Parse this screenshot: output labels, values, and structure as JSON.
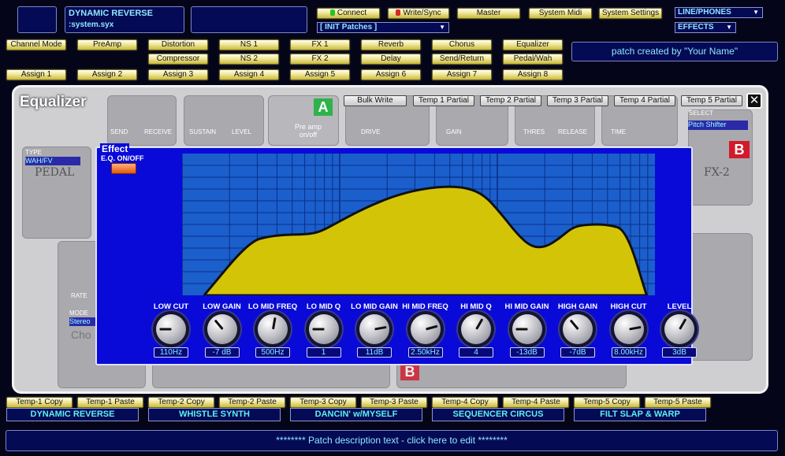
{
  "header": {
    "patch_name": "DYNAMIC REVERSE",
    "file_name": ":system.syx",
    "connect": "Connect",
    "write_sync": "Write/Sync",
    "master": "Master",
    "system_midi": "System Midi",
    "system_settings": "System Settings",
    "patch_select": "[ INIT Patches ]",
    "output_select": "LINE/PHONES",
    "mode_select": "EFFECTS",
    "connect_led": "#27c41f",
    "write_led": "#d9262b"
  },
  "effects_row1": [
    "Channel Mode",
    "PreAmp",
    "Distortion",
    "NS 1",
    "FX 1",
    "Reverb",
    "Chorus",
    "Equalizer"
  ],
  "effects_row2": [
    "Compressor",
    "NS 2",
    "FX 2",
    "Delay",
    "Send/Return",
    "Pedal/Wah"
  ],
  "patch_created": "patch created by \"Your Name\"",
  "assigns": [
    "Assign 1",
    "Assign 2",
    "Assign 3",
    "Assign 4",
    "Assign 5",
    "Assign 6",
    "Assign 7",
    "Assign 8"
  ],
  "panel": {
    "title": "Equalizer",
    "bulk_write": "Bulk Write",
    "temp_partials": [
      "Temp 1 Partial",
      "Temp 2 Partial",
      "Temp 3 Partial",
      "Temp 4 Partial",
      "Temp 5 Partial"
    ],
    "close": "✕",
    "bg": {
      "send": "SEND",
      "receive": "RECEIVE",
      "sustain": "SUSTAIN",
      "level": "LEVEL",
      "preamp_onoff": "Pre amp\non/off",
      "a_letter": "A",
      "b_letter": "B",
      "drive": "DRIVE",
      "gain": "GAIN",
      "thres": "THRES",
      "release": "RELEASE",
      "time": "TIME",
      "select": "SELECT",
      "fx_select": "Pitch Shifter",
      "type": "TYPE",
      "type_value": "WAH/FV",
      "pedal": "PEDAL",
      "fx2": "FX-2",
      "rate": "RATE",
      "mode": "MODE",
      "mode_value": "Stereo",
      "cho": "Cho"
    }
  },
  "eq": {
    "effect_label": "Effect",
    "onoff_label": "E.Q. ON/OFF",
    "curve": [
      [
        0.0,
        100
      ],
      [
        0.1,
        62
      ],
      [
        0.15,
        58
      ],
      [
        0.2,
        57
      ],
      [
        0.23,
        57
      ],
      [
        0.26,
        55
      ],
      [
        0.3,
        48
      ],
      [
        0.36,
        38
      ],
      [
        0.43,
        29
      ],
      [
        0.5,
        24
      ],
      [
        0.57,
        23
      ],
      [
        0.62,
        28
      ],
      [
        0.66,
        42
      ],
      [
        0.7,
        58
      ],
      [
        0.73,
        66
      ],
      [
        0.76,
        66
      ],
      [
        0.79,
        60
      ],
      [
        0.82,
        52
      ],
      [
        0.85,
        50
      ],
      [
        0.9,
        50
      ],
      [
        0.94,
        54
      ],
      [
        0.985,
        100
      ]
    ],
    "knobs": [
      {
        "label": "LOW CUT",
        "value": "110Hz",
        "angle": -90
      },
      {
        "label": "LOW GAIN",
        "value": "-7 dB",
        "angle": -40
      },
      {
        "label": "LO MID FREQ",
        "value": "500Hz",
        "angle": 10
      },
      {
        "label": "LO MID Q",
        "value": "1",
        "angle": -90
      },
      {
        "label": "LO MID GAIN",
        "value": "11dB",
        "angle": 80
      },
      {
        "label": "HI MID FREQ",
        "value": "2.50kHz",
        "angle": 75
      },
      {
        "label": "HI MID Q",
        "value": "4",
        "angle": 30
      },
      {
        "label": "HI MID GAIN",
        "value": "-13dB",
        "angle": -90
      },
      {
        "label": "HIGH GAIN",
        "value": "-7dB",
        "angle": -40
      },
      {
        "label": "HIGH CUT",
        "value": "8.00kHz",
        "angle": 80
      },
      {
        "label": "LEVEL",
        "value": "3dB",
        "angle": 30
      }
    ]
  },
  "temp_copy_paste": [
    "Temp-1 Copy",
    "Temp-1 Paste",
    "Temp-2 Copy",
    "Temp-2 Paste",
    "Temp-3 Copy",
    "Temp-3 Paste",
    "Temp-4 Copy",
    "Temp-4 Paste",
    "Temp-5 Copy",
    "Temp-5 Paste"
  ],
  "temp_patches": [
    "DYNAMIC REVERSE",
    "WHISTLE SYNTH",
    "DANCIN' w/MYSELF",
    "SEQUENCER CIRCUS",
    "FILT SLAP & WARP"
  ],
  "description": "******** Patch description text - click here to edit ********"
}
